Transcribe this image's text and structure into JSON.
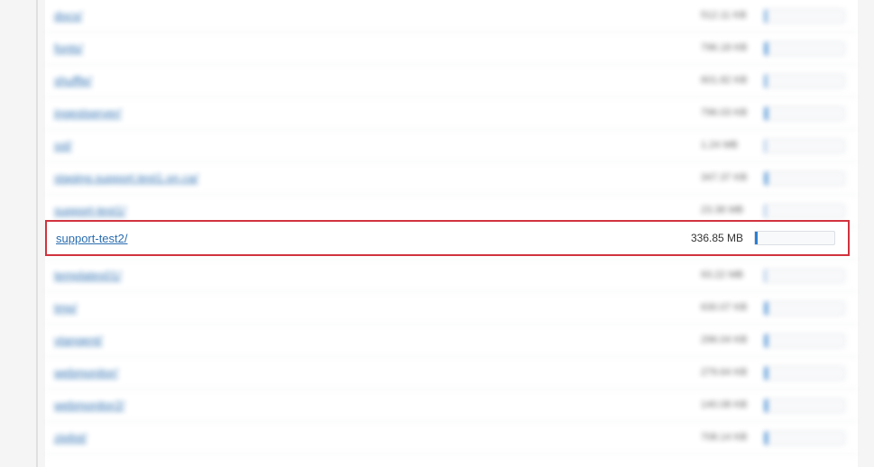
{
  "highlighted": {
    "name": "support-test2/",
    "size": "336.85 MB",
    "usage_pct": 3
  },
  "rows": [
    {
      "name": "docs/",
      "size": "512.11 KB",
      "usage_pct": 2
    },
    {
      "name": "fonts/",
      "size": "796.18 KB",
      "usage_pct": 3
    },
    {
      "name": "shuffle/",
      "size": "601.82 KB",
      "usage_pct": 2
    },
    {
      "name": "ingestserver/",
      "size": "796.03 KB",
      "usage_pct": 3
    },
    {
      "name": "ssl/",
      "size": "1.24 MB",
      "usage_pct": 1
    },
    {
      "name": "staging.support.test1.on.ca/",
      "size": "347.37 KB",
      "usage_pct": 3
    },
    {
      "name": "support-test1/",
      "size": "23.38 MB",
      "usage_pct": 1
    },
    {
      "name": "support-test2/",
      "size": "336.85 MB",
      "usage_pct": 3
    },
    {
      "name": "templates01/",
      "size": "93.22 MB",
      "usage_pct": 1
    },
    {
      "name": "tmp/",
      "size": "630.07 KB",
      "usage_pct": 3
    },
    {
      "name": "vtangent/",
      "size": "296.04 KB",
      "usage_pct": 3
    },
    {
      "name": "webmonitor/",
      "size": "279.64 KB",
      "usage_pct": 3
    },
    {
      "name": "webmonitor2/",
      "size": "140.08 KB",
      "usage_pct": 3
    },
    {
      "name": "ziplist/",
      "size": "708.14 KB",
      "usage_pct": 3
    }
  ]
}
